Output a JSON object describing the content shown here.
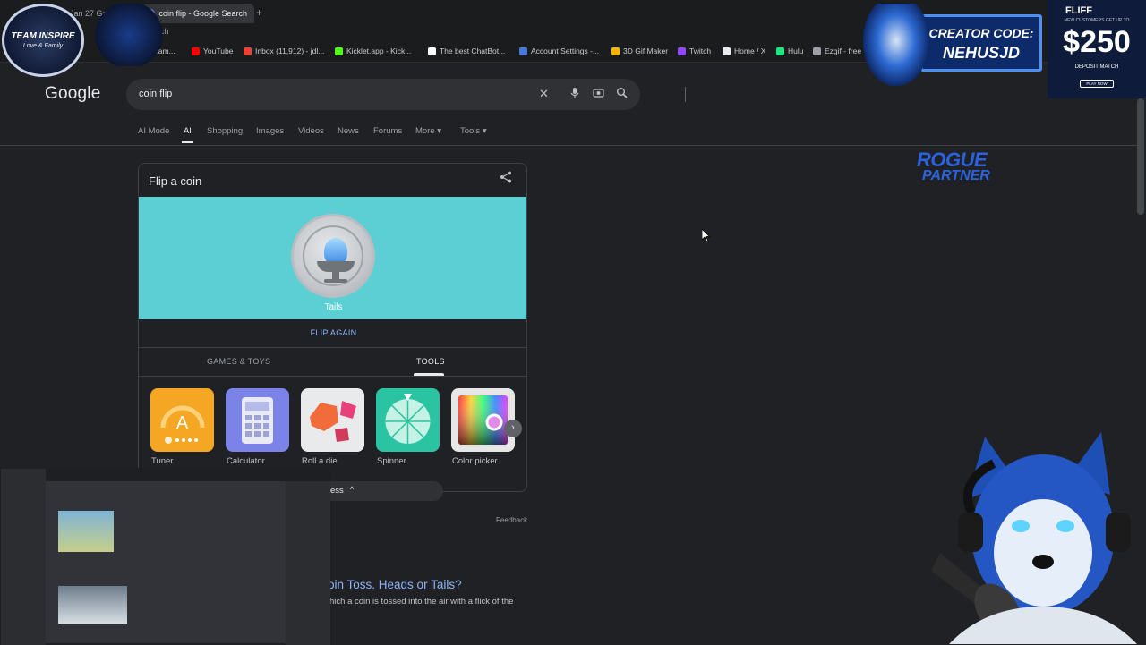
{
  "browser": {
    "tabs": [
      {
        "label": "Jan 27 Gam"
      },
      {
        "label": "coin flip - Google Search"
      }
    ],
    "new_tab": "+",
    "url_fragment": "rch",
    "bookmarks": [
      {
        "label": "eam...",
        "color": "#2a62e0"
      },
      {
        "label": "YouTube",
        "color": "#ff0000"
      },
      {
        "label": "Inbox (11,912) - jdl...",
        "color": "#ea4335"
      },
      {
        "label": "Kicklet.app - Kick...",
        "color": "#53fc18"
      },
      {
        "label": "The best ChatBot...",
        "color": "#ffffff"
      },
      {
        "label": "Account Settings -...",
        "color": "#4a78d8"
      },
      {
        "label": "3D Gif Maker",
        "color": "#f4b400"
      },
      {
        "label": "Twitch",
        "color": "#9146ff"
      },
      {
        "label": "Home / X",
        "color": "#e8eaed"
      },
      {
        "label": "Hulu",
        "color": "#1ce783"
      },
      {
        "label": "Ezgif - free",
        "color": "#9aa0a6"
      }
    ]
  },
  "google": {
    "logo": "Google",
    "query": "coin flip",
    "icons": [
      "close-icon",
      "microphone-icon",
      "camera-icon",
      "search-icon"
    ],
    "tabs": [
      "AI Mode",
      "All",
      "Shopping",
      "Images",
      "Videos",
      "News",
      "Forums",
      "More ▾",
      "Tools ▾"
    ],
    "selected_tab": "All"
  },
  "coin_card": {
    "title": "Flip a coin",
    "result": "Tails",
    "flip_again": "FLIP AGAIN",
    "tab_games": "GAMES & TOYS",
    "tab_tools": "TOOLS",
    "tools": [
      {
        "label": "Tuner",
        "icon": "tuner-icon",
        "color": "#f5a623"
      },
      {
        "label": "Calculator",
        "icon": "calculator-icon",
        "color": "#7c83e8"
      },
      {
        "label": "Roll a die",
        "icon": "dice-icon",
        "color": "#e9eaec"
      },
      {
        "label": "Spinner",
        "icon": "spinner-icon",
        "color": "#2bc4a2"
      },
      {
        "label": "Color picker",
        "icon": "color-picker-icon",
        "color": "#e6e6e6"
      }
    ],
    "show_less": "ess",
    "feedback": "Feedback",
    "accent": "#5ccfd4"
  },
  "result": {
    "title": "oin Toss. Heads or Tails?",
    "snippet": "hich a coin is tossed into the air with a flick of the"
  },
  "overlays": {
    "team_logo_l1": "TEAM INSPIRE",
    "team_logo_l2": "Love & Family",
    "creator_l1": "CREATOR CODE:",
    "creator_l2": "NEHUSJD",
    "fliff_name": "FLIFF",
    "fliff_promo": "NEW CUSTOMERS GET UP TO",
    "fliff_amount": "$250",
    "fliff_match": "DEPOSIT MATCH",
    "fliff_play": "PLAY NOW",
    "rogue_l1": "ROGUE",
    "rogue_l2": "PARTNER"
  }
}
